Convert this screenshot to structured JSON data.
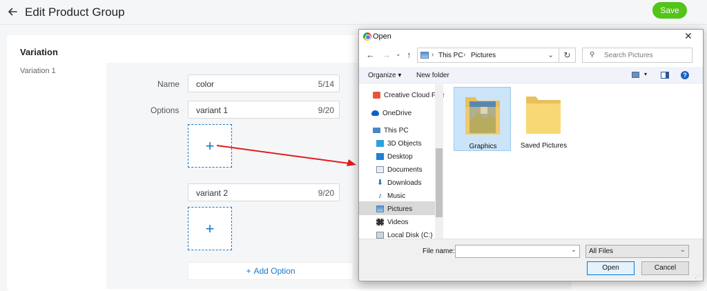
{
  "page": {
    "title": "Edit Product Group",
    "save_label": "Save"
  },
  "variation": {
    "section_title": "Variation",
    "label": "Variation 1",
    "name_label": "Name",
    "name_value": "color",
    "name_count": "5/14",
    "options_label": "Options",
    "options": [
      {
        "value": "variant 1",
        "count": "9/20"
      },
      {
        "value": "variant 2",
        "count": "9/20"
      }
    ],
    "add_option_label": "Add Option"
  },
  "dialog": {
    "title": "Open",
    "breadcrumb": [
      "This PC",
      "Pictures"
    ],
    "search_placeholder": "Search Pictures",
    "organize_label": "Organize",
    "new_folder_label": "New folder",
    "nav_items": [
      {
        "label": "Creative Cloud Files",
        "icon": "creative-cloud-icon"
      },
      {
        "label": "OneDrive",
        "icon": "onedrive-icon"
      },
      {
        "label": "This PC",
        "icon": "this-pc-icon"
      },
      {
        "label": "3D Objects",
        "icon": "3d-objects-icon"
      },
      {
        "label": "Desktop",
        "icon": "desktop-icon"
      },
      {
        "label": "Documents",
        "icon": "documents-icon"
      },
      {
        "label": "Downloads",
        "icon": "downloads-icon"
      },
      {
        "label": "Music",
        "icon": "music-icon"
      },
      {
        "label": "Pictures",
        "icon": "pictures-icon",
        "selected": true
      },
      {
        "label": "Videos",
        "icon": "videos-icon"
      },
      {
        "label": "Local Disk (C:)",
        "icon": "local-disk-icon"
      }
    ],
    "files": [
      {
        "label": "Graphics",
        "selected": true
      },
      {
        "label": "Saved Pictures",
        "selected": false
      }
    ],
    "file_name_label": "File name:",
    "file_name_value": "",
    "filter_value": "All Files",
    "open_label": "Open",
    "cancel_label": "Cancel"
  },
  "colors": {
    "accent": "#1677c9",
    "save_green": "#52c41a",
    "arrow_red": "#e31b1b"
  }
}
